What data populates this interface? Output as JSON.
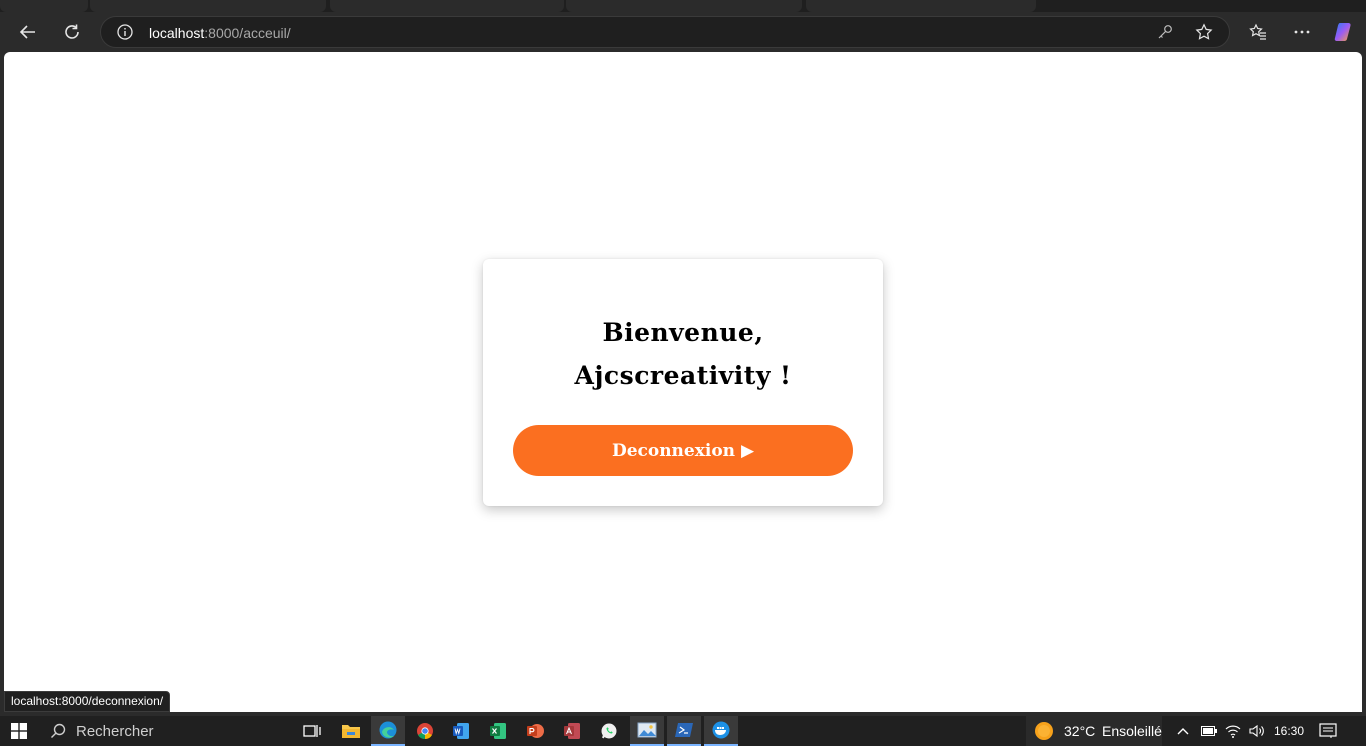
{
  "browser": {
    "address_host": "localhost",
    "address_rest": ":8000/acceuil/",
    "icons": [
      "back-icon",
      "refresh-icon",
      "info-icon",
      "key-icon",
      "star-icon",
      "favorites-icon",
      "more-icon",
      "copilot-icon"
    ]
  },
  "page": {
    "greeting_line1": "Bienvenue,",
    "greeting_line2": "Ajcscreativity !",
    "logout_label": "Deconnexion ▶",
    "accent_color": "#fb6f20"
  },
  "status_url": "localhost:8000/deconnexion/",
  "taskbar": {
    "search_placeholder": "Rechercher",
    "apps": [
      "file-explorer",
      "edge",
      "chrome",
      "word",
      "excel",
      "powerpoint",
      "access",
      "whatsapp",
      "photos",
      "powershell",
      "docker"
    ],
    "weather_temp": "32°C",
    "weather_desc": "Ensoleillé",
    "time": "16:30"
  }
}
